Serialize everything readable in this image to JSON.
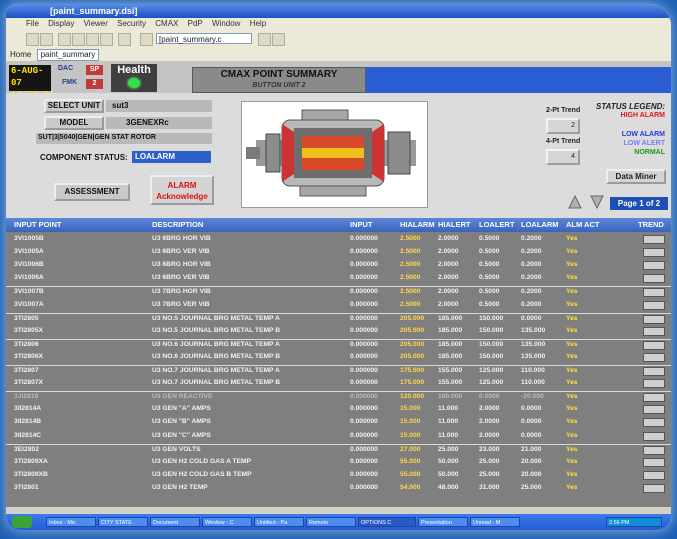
{
  "window": {
    "title": "[paint_summary.dsi]"
  },
  "menu": [
    "File",
    "Display",
    "Viewer",
    "Security",
    "CMAX",
    "PdP",
    "Window",
    "Help"
  ],
  "toolbar": {
    "combo_value": "[paint_summary.c"
  },
  "address": {
    "label": "Home",
    "value": "paint_summary"
  },
  "header": {
    "date": "6-AUG-07",
    "time": "14:51:24",
    "dac_label": "DAC",
    "dac_value": "SP",
    "fmk_label": "FMK",
    "fmk_value": "2",
    "health_label": "Health",
    "title": "CMAX POINT SUMMARY",
    "subtitle": "BUTTON UNIT 2"
  },
  "panel": {
    "select_unit_label": "SELECT UNIT",
    "select_unit_value": "sut3",
    "model_label": "MODEL",
    "model_value": "3GENEXRc",
    "path": "SUT|3|5040|GEN|GEN STAT ROTOR",
    "status_label": "COMPONENT STATUS:",
    "status_value": "LOALARM",
    "assessment_label": "ASSESSMENT",
    "alarm_line1": "ALARM",
    "alarm_line2": "Acknowledge",
    "trend2_label": "2-Pt Trend",
    "trend2_btn": "2",
    "trend4_label": "4-Pt Trend",
    "trend4_btn": "4",
    "data_miner_label": "Data Miner",
    "page_label": "Page 1 of 2"
  },
  "legend": {
    "title": "STATUS LEGEND:",
    "items": [
      {
        "label": "HIGH ALARM",
        "color": "#e01a1a"
      },
      {
        "label": "LOW ALARM",
        "color": "#1f3fd6"
      },
      {
        "label": "LOW ALERT",
        "color": "#7a7aff"
      },
      {
        "label": "NORMAL",
        "color": "#1a9a1a"
      }
    ]
  },
  "table": {
    "columns": [
      "INPUT POINT",
      "DESCRIPTION",
      "INPUT",
      "HIALARM",
      "HIALERT",
      "LOALERT",
      "LOALARM",
      "ALM ACT",
      "TREND"
    ],
    "rows": [
      [
        "3VI1005B",
        "U3 6BRG HOR VIB",
        "0.000000",
        "2.5000",
        "2.0000",
        "0.5000",
        "0.2000",
        "Yes"
      ],
      [
        "3VI1005A",
        "U3 6BRG VER VIB",
        "0.000000",
        "2.5000",
        "2.0000",
        "0.5000",
        "0.2000",
        "Yes"
      ],
      [
        "3VI1006B",
        "U3 6BRG HOR VIB",
        "0.000000",
        "2.5000",
        "2.0000",
        "0.5000",
        "0.2000",
        "Yes"
      ],
      [
        "3VI1006A",
        "U3 6BRG VER VIB",
        "0.000000",
        "2.5000",
        "2.0000",
        "0.5000",
        "0.2000",
        "Yes"
      ],
      [
        "3VI1007B",
        "U3 7BRG HOR VIB",
        "0.000000",
        "2.5000",
        "2.0000",
        "0.5000",
        "0.2000",
        "Yes"
      ],
      [
        "3VI1007A",
        "U3 7BRG VER VIB",
        "0.000000",
        "2.5000",
        "2.0000",
        "0.5000",
        "0.2000",
        "Yes"
      ],
      [
        "3TI2805",
        "U3 NO.5 JOURNAL BRG METAL TEMP A",
        "0.000000",
        "205.000",
        "185.000",
        "150.000",
        "0.0000",
        "Yes"
      ],
      [
        "3TI2805X",
        "U3 NO.5 JOURNAL BRG METAL TEMP B",
        "0.000000",
        "205.000",
        "185.000",
        "150.000",
        "135.000",
        "Yes"
      ],
      [
        "3TI2806",
        "U3 NO.6 JOURNAL BRG METAL TEMP A",
        "0.000000",
        "205.000",
        "185.000",
        "150.000",
        "135.000",
        "Yes"
      ],
      [
        "3TI2806X",
        "U3 NO.6 JOURNAL BRG METAL TEMP B",
        "0.000000",
        "205.000",
        "185.000",
        "150.000",
        "135.000",
        "Yes"
      ],
      [
        "3TI2807",
        "U3 NO.7 JOURNAL BRG METAL TEMP A",
        "0.000000",
        "175.000",
        "155.000",
        "125.000",
        "110.000",
        "Yes"
      ],
      [
        "3TI2807X",
        "U3 NO.7 JOURNAL BRG METAL TEMP B",
        "0.000000",
        "175.000",
        "155.000",
        "125.000",
        "110.000",
        "Yes"
      ],
      [
        "3JI2819",
        "U3 GEN REACTIVE",
        "0.000000",
        "120.000",
        "100.000",
        "0.0000",
        "-20.000",
        "Yes"
      ],
      [
        "3II2814A",
        "U3 GEN \"A\" AMPS",
        "0.000000",
        "15.000",
        "11.000",
        "2.0000",
        "0.0000",
        "Yes"
      ],
      [
        "3II2814B",
        "U3 GEN \"B\" AMPS",
        "0.000000",
        "15.000",
        "11.000",
        "2.0000",
        "0.0000",
        "Yes"
      ],
      [
        "3II2814C",
        "U3 GEN \"C\" AMPS",
        "0.000000",
        "15.000",
        "11.000",
        "2.0000",
        "0.0000",
        "Yes"
      ],
      [
        "3EI2802",
        "U3 GEN VOLTS",
        "0.000000",
        "27.000",
        "25.000",
        "23.000",
        "21.000",
        "Yes"
      ],
      [
        "3TI2809XA",
        "U3 GEN H2 COLD GAS A TEMP",
        "0.000000",
        "55.000",
        "50.000",
        "25.000",
        "20.000",
        "Yes"
      ],
      [
        "3TI2809XB",
        "U3 GEN H2 COLD GAS B TEMP",
        "0.000000",
        "55.000",
        "50.000",
        "25.000",
        "20.000",
        "Yes"
      ],
      [
        "3TI2801",
        "U3 GEN H2 TEMP",
        "0.000000",
        "54.000",
        "48.000",
        "31.000",
        "25.000",
        "Yes"
      ]
    ]
  },
  "taskbar": {
    "items": [
      "Inbox - Mic",
      "CITY STATE",
      "Document",
      "Window - C",
      "Untitled - Pa",
      "Remote",
      "OPTIONS C",
      "Presentation",
      "Unread - M"
    ],
    "tray": "2:56 PM"
  }
}
